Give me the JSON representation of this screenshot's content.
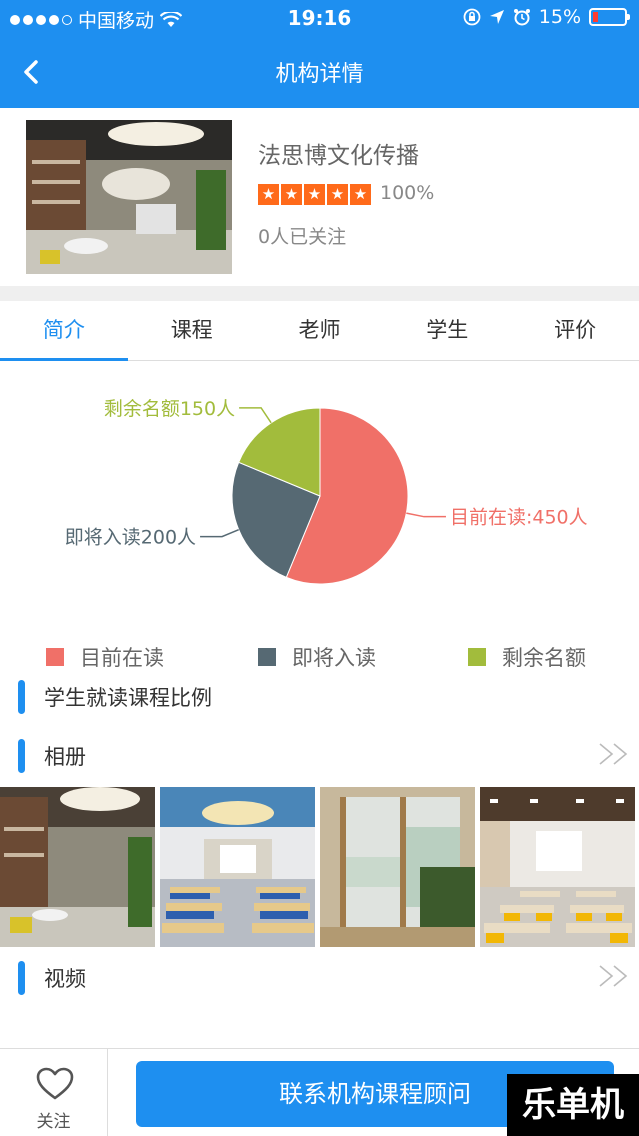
{
  "status_bar": {
    "carrier": "中国移动",
    "time": "19:16",
    "battery": "15%"
  },
  "header": {
    "title": "机构详情"
  },
  "org": {
    "name": "法思博文化传播",
    "rating": "100%",
    "stars": 5,
    "followers": "0人已关注"
  },
  "tabs": [
    {
      "label": "简介",
      "active": true
    },
    {
      "label": "课程",
      "active": false
    },
    {
      "label": "老师",
      "active": false
    },
    {
      "label": "学生",
      "active": false
    },
    {
      "label": "评价",
      "active": false
    }
  ],
  "chart_data": {
    "type": "pie",
    "slices": [
      {
        "name": "目前在读",
        "value": 450,
        "label": "目前在读:450人",
        "color": "#f07068"
      },
      {
        "name": "即将入读",
        "value": 200,
        "label": "即将入读200人",
        "color": "#566973"
      },
      {
        "name": "剩余名额",
        "value": 150,
        "label": "剩余名额150人",
        "color": "#a2bc3c"
      }
    ],
    "legend": [
      "目前在读",
      "即将入读",
      "剩余名额"
    ],
    "legend_position": "bottom"
  },
  "sections": {
    "chart_title": "学生就读课程比例",
    "album": "相册",
    "video": "视频"
  },
  "bottom_bar": {
    "follow_label": "关注",
    "contact_label": "联系机构课程顾问"
  },
  "watermark": "乐单机"
}
